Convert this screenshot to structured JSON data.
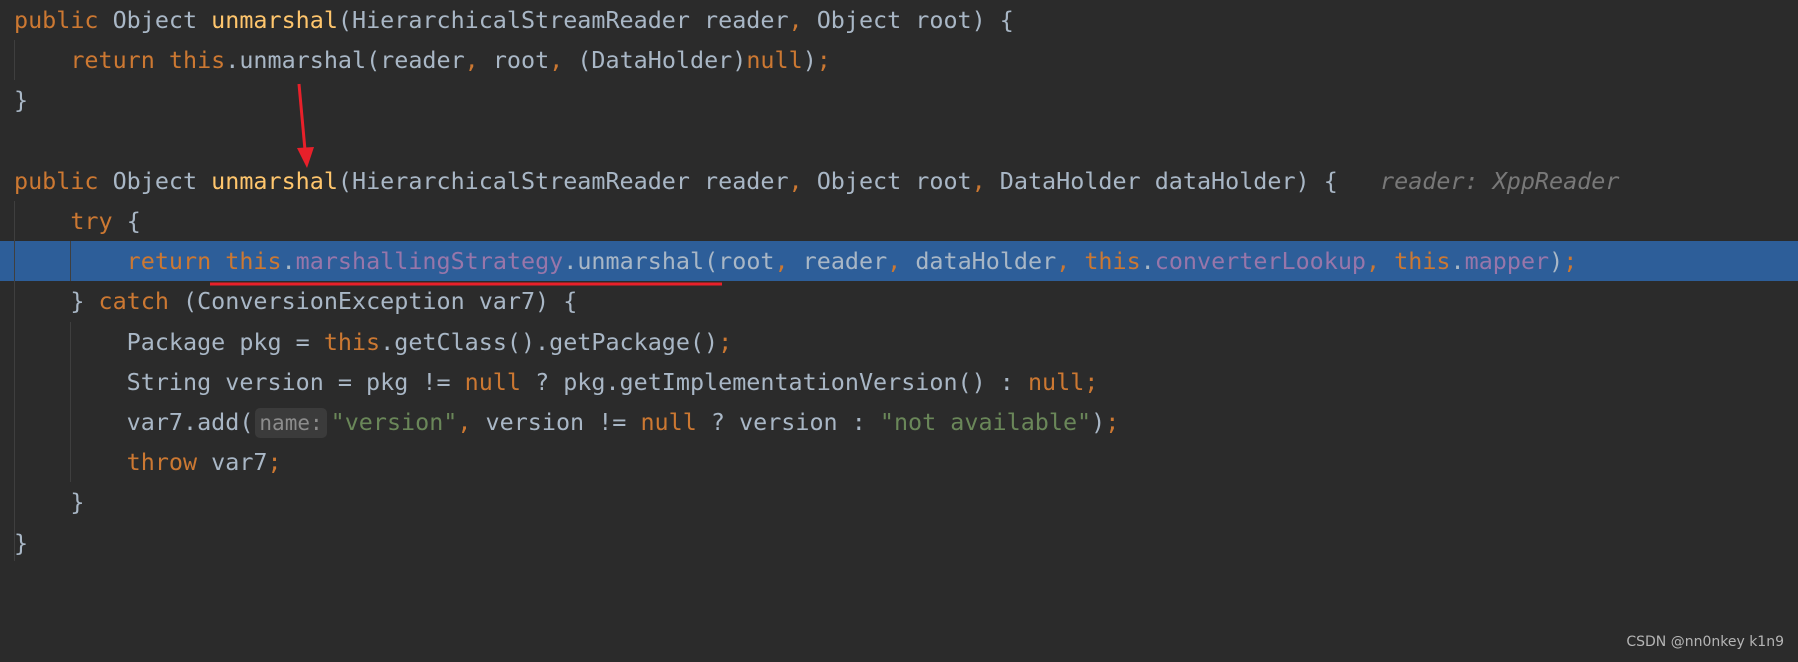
{
  "colors": {
    "keyword": "#cc7832",
    "text": "#a9b7c6",
    "method_decl": "#ffc66d",
    "field": "#9876aa",
    "string": "#6a8759",
    "hint": "#787878",
    "highlight": "#2d5e99",
    "annotation": "#e8202a"
  },
  "code": {
    "highlighted_line": 6,
    "lines": [
      [
        [
          "kw",
          "public "
        ],
        [
          "tx",
          "Object "
        ],
        [
          "fn",
          "unmarshal"
        ],
        [
          "tx",
          "(HierarchicalStreamReader reader"
        ],
        [
          "kw",
          ", "
        ],
        [
          "tx",
          "Object root) {"
        ]
      ],
      [
        [
          "tx",
          "    "
        ],
        [
          "kw",
          "return this"
        ],
        [
          "tx",
          ".unmarshal(reader"
        ],
        [
          "kw",
          ", "
        ],
        [
          "tx",
          "root"
        ],
        [
          "kw",
          ", "
        ],
        [
          "tx",
          "(DataHolder)"
        ],
        [
          "kw",
          "null"
        ],
        [
          "tx",
          ")"
        ],
        [
          "kw",
          ";"
        ]
      ],
      [
        [
          "tx",
          "}"
        ]
      ],
      [],
      [
        [
          "kw",
          "public "
        ],
        [
          "tx",
          "Object "
        ],
        [
          "fn",
          "unmarshal"
        ],
        [
          "tx",
          "(HierarchicalStreamReader reader"
        ],
        [
          "kw",
          ", "
        ],
        [
          "tx",
          "Object root"
        ],
        [
          "kw",
          ", "
        ],
        [
          "tx",
          "DataHolder dataHolder) {   "
        ],
        [
          "hint",
          "reader: XppReader"
        ]
      ],
      [
        [
          "tx",
          "    "
        ],
        [
          "kw",
          "try "
        ],
        [
          "tx",
          "{"
        ]
      ],
      [
        [
          "tx",
          "        "
        ],
        [
          "kw",
          "return this"
        ],
        [
          "tx",
          "."
        ],
        [
          "fd",
          "marshallingStrategy"
        ],
        [
          "tx",
          ".unmarshal(root"
        ],
        [
          "kw",
          ", "
        ],
        [
          "tx",
          "reader"
        ],
        [
          "kw",
          ", "
        ],
        [
          "tx",
          "dataHolder"
        ],
        [
          "kw",
          ", this"
        ],
        [
          "tx",
          "."
        ],
        [
          "fd",
          "converterLookup"
        ],
        [
          "kw",
          ", this"
        ],
        [
          "tx",
          "."
        ],
        [
          "fd",
          "mapper"
        ],
        [
          "tx",
          ")"
        ],
        [
          "kw",
          ";"
        ]
      ],
      [
        [
          "tx",
          "    } "
        ],
        [
          "kw",
          "catch "
        ],
        [
          "tx",
          "(ConversionException var7) {"
        ]
      ],
      [
        [
          "tx",
          "        Package pkg = "
        ],
        [
          "kw",
          "this"
        ],
        [
          "tx",
          ".getClass().getPackage()"
        ],
        [
          "kw",
          ";"
        ]
      ],
      [
        [
          "tx",
          "        String version = pkg != "
        ],
        [
          "kw",
          "null "
        ],
        [
          "tx",
          "? pkg.getImplementationVersion() : "
        ],
        [
          "kw",
          "null"
        ],
        [
          "kw",
          ";"
        ]
      ],
      [
        [
          "tx",
          "        var7.add("
        ],
        [
          "ph",
          "name:"
        ],
        [
          "st",
          "\"version\""
        ],
        [
          "kw",
          ", "
        ],
        [
          "tx",
          "version != "
        ],
        [
          "kw",
          "null "
        ],
        [
          "tx",
          "? version : "
        ],
        [
          "st",
          "\"not available\""
        ],
        [
          "tx",
          ")"
        ],
        [
          "kw",
          ";"
        ]
      ],
      [
        [
          "tx",
          "        "
        ],
        [
          "kw",
          "throw "
        ],
        [
          "tx",
          "var7"
        ],
        [
          "kw",
          ";"
        ]
      ],
      [
        [
          "tx",
          "    }"
        ]
      ],
      [
        [
          "tx",
          "}"
        ]
      ]
    ]
  },
  "watermark": "CSDN @nn0nkey k1n9"
}
